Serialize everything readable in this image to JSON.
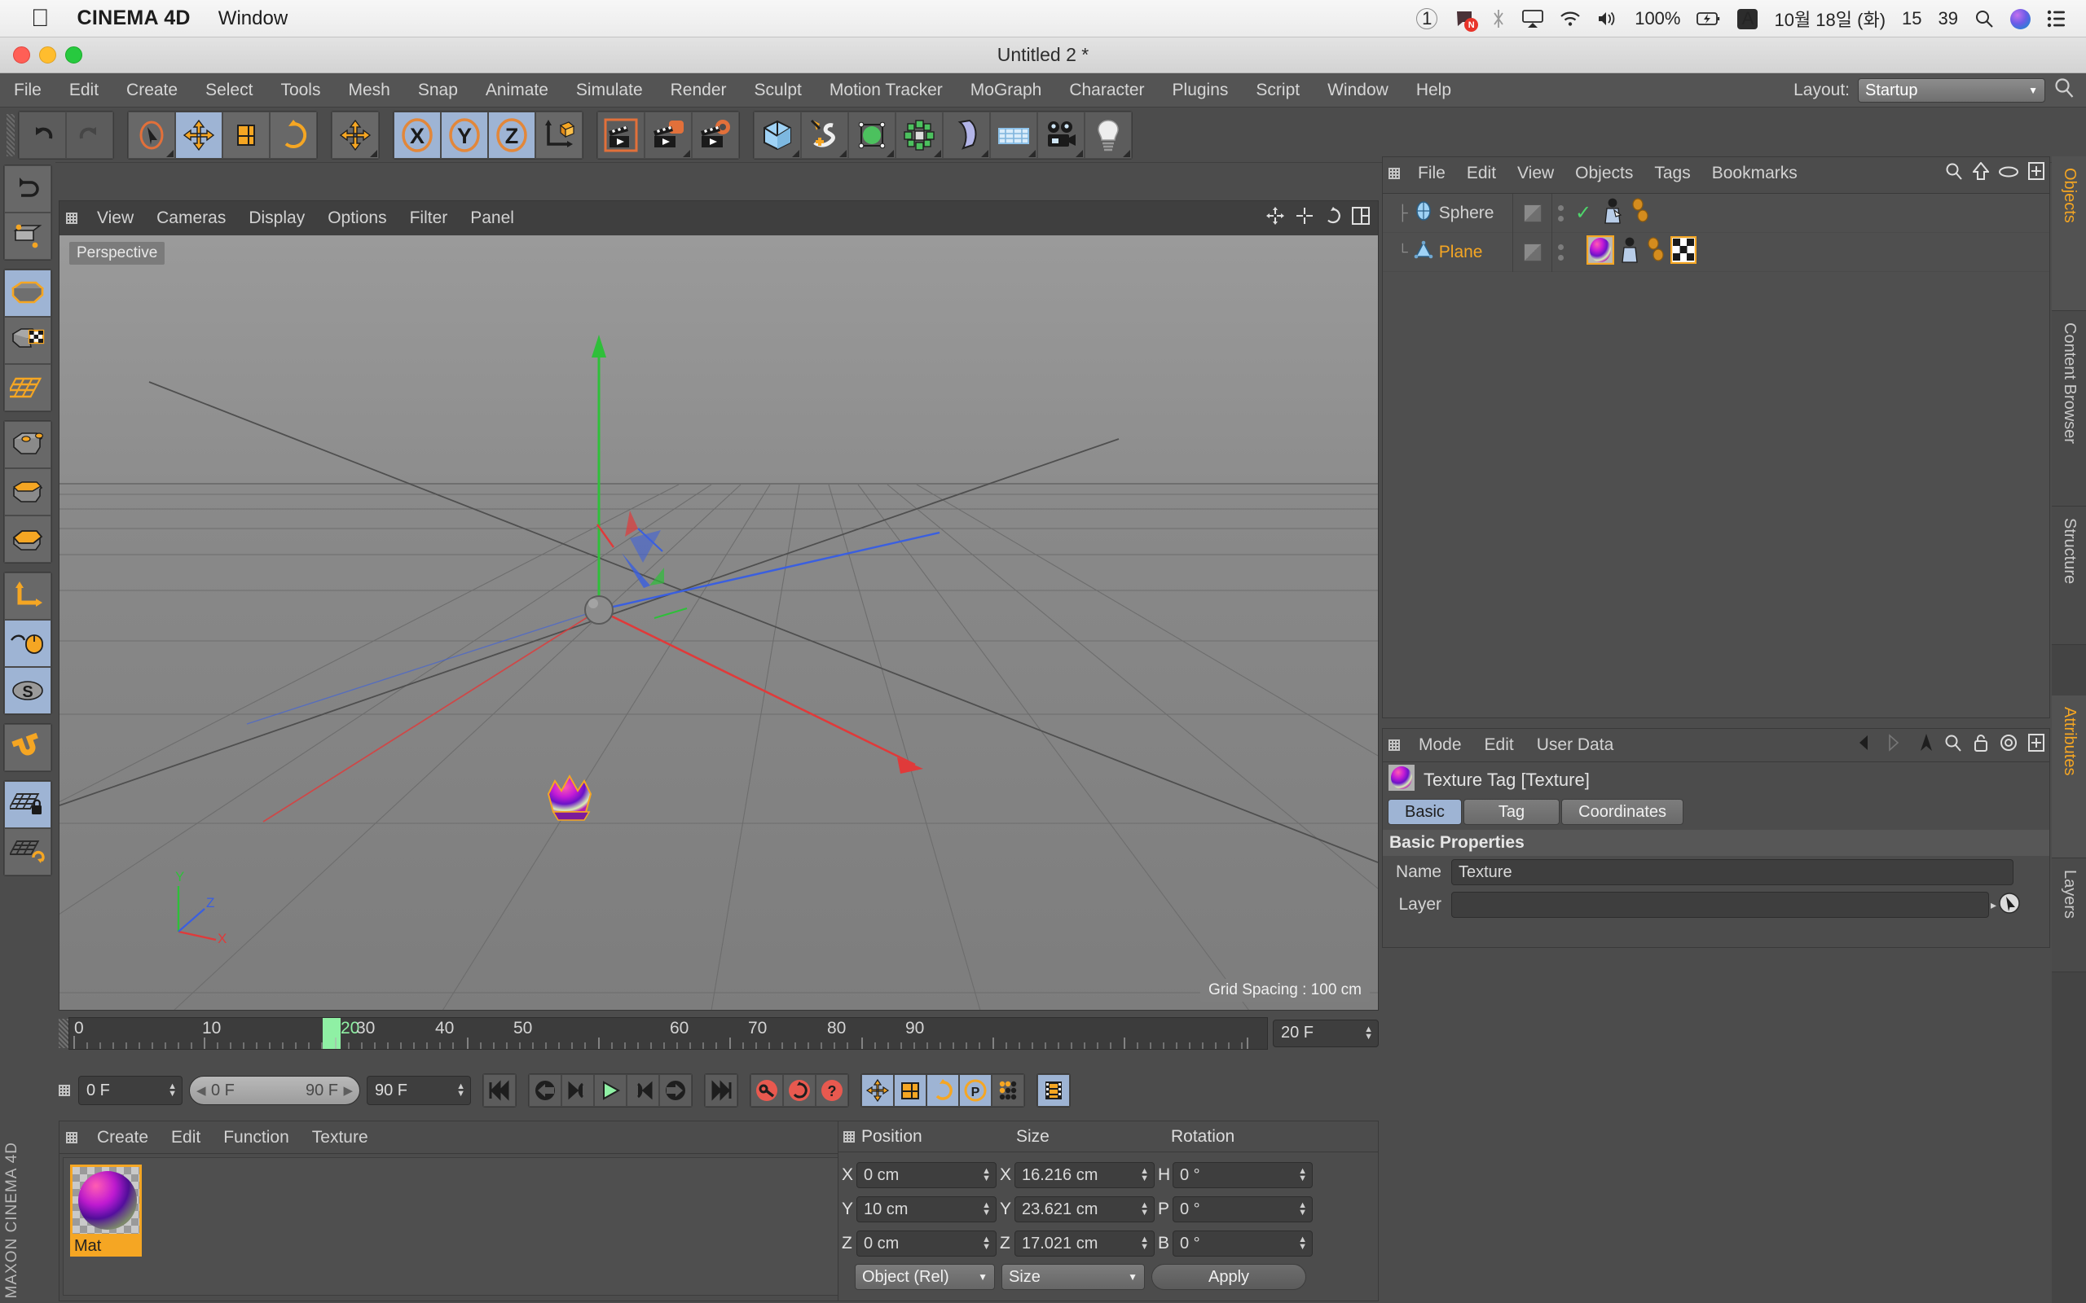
{
  "mac_menubar": {
    "apple_icon": "apple-icon",
    "app_name": "CINEMA 4D",
    "menus": [
      "Window"
    ],
    "status": {
      "space_number": "1",
      "notification_badge": "N",
      "battery_percent": "100%",
      "keyboard_layout": "A",
      "date": "10월 18일 (화)",
      "time_hour": "15",
      "time_minute": "39",
      "icons": [
        "bluetooth-icon",
        "airplay-icon",
        "wifi-icon",
        "volume-icon",
        "battery-charging-icon",
        "search-icon",
        "siri-icon",
        "control-center-icon"
      ]
    }
  },
  "window": {
    "title": "Untitled 2 *"
  },
  "main_menu": {
    "items": [
      "File",
      "Edit",
      "Create",
      "Select",
      "Tools",
      "Mesh",
      "Snap",
      "Animate",
      "Simulate",
      "Render",
      "Sculpt",
      "Motion Tracker",
      "MoGraph",
      "Character",
      "Plugins",
      "Script",
      "Window",
      "Help"
    ],
    "layout_label": "Layout:",
    "layout_value": "Startup",
    "search_icon": "search-icon"
  },
  "top_toolbar": {
    "groups": [
      {
        "name": "history",
        "buttons": [
          {
            "name": "undo-button",
            "icon": "undo-icon",
            "selected": false,
            "enabled": true
          },
          {
            "name": "redo-button",
            "icon": "redo-icon",
            "selected": false,
            "enabled": false
          }
        ]
      },
      {
        "name": "tools",
        "buttons": [
          {
            "name": "live-selection-tool",
            "icon": "live-selection-icon",
            "selected": false,
            "enabled": true
          },
          {
            "name": "move-tool",
            "icon": "move-icon",
            "selected": true,
            "enabled": true
          },
          {
            "name": "scale-tool",
            "icon": "scale-icon",
            "selected": false,
            "enabled": true
          },
          {
            "name": "rotate-tool",
            "icon": "rotate-icon",
            "selected": false,
            "enabled": true
          }
        ]
      },
      {
        "name": "transform",
        "buttons": [
          {
            "name": "move-duplicate-tool",
            "icon": "move-axis-icon",
            "selected": false,
            "enabled": true
          }
        ]
      },
      {
        "name": "axis-locks",
        "buttons": [
          {
            "name": "lock-x-axis",
            "icon": "x-axis-icon",
            "selected": true,
            "enabled": true
          },
          {
            "name": "lock-y-axis",
            "icon": "y-axis-icon",
            "selected": true,
            "enabled": true
          },
          {
            "name": "lock-z-axis",
            "icon": "z-axis-icon",
            "selected": true,
            "enabled": true
          },
          {
            "name": "world-object-coordinates",
            "icon": "world-axis-icon",
            "selected": false,
            "enabled": true
          }
        ]
      },
      {
        "name": "render",
        "buttons": [
          {
            "name": "render-view-button",
            "icon": "render-view-icon",
            "selected": false,
            "enabled": true
          },
          {
            "name": "render-region-button",
            "icon": "render-region-icon",
            "selected": false,
            "enabled": true
          },
          {
            "name": "render-settings-button",
            "icon": "render-settings-icon",
            "selected": false,
            "enabled": true
          }
        ]
      },
      {
        "name": "primitives",
        "buttons": [
          {
            "name": "add-cube-button",
            "icon": "cube-icon",
            "selected": false,
            "enabled": true
          },
          {
            "name": "add-spline-button",
            "icon": "pen-spline-icon",
            "selected": false,
            "enabled": true
          },
          {
            "name": "add-generator-button",
            "icon": "generator-icon",
            "selected": false,
            "enabled": true
          },
          {
            "name": "add-array-button",
            "icon": "array-icon",
            "selected": false,
            "enabled": true
          },
          {
            "name": "add-bend-deformer-button",
            "icon": "bend-deformer-icon",
            "selected": false,
            "enabled": true
          },
          {
            "name": "add-floor-button",
            "icon": "floor-grid-icon",
            "selected": false,
            "enabled": true
          },
          {
            "name": "add-camera-button",
            "icon": "camera-icon",
            "selected": false,
            "enabled": true
          },
          {
            "name": "add-light-button",
            "icon": "light-bulb-icon",
            "selected": false,
            "enabled": true
          }
        ]
      }
    ]
  },
  "left_toolbar": {
    "groups": [
      {
        "buttons": [
          {
            "name": "undo-view-button",
            "icon": "undo-view-icon",
            "selected": false
          },
          {
            "name": "editable-object-button",
            "icon": "make-editable-icon",
            "selected": false
          }
        ]
      },
      {
        "buttons": [
          {
            "name": "model-mode-button",
            "icon": "model-mode-icon",
            "selected": true
          },
          {
            "name": "texture-mode-button",
            "icon": "texture-mode-icon",
            "selected": false
          },
          {
            "name": "workplane-button",
            "icon": "workplane-icon",
            "selected": false
          }
        ]
      },
      {
        "buttons": [
          {
            "name": "points-mode-button",
            "icon": "points-mode-icon",
            "selected": false
          },
          {
            "name": "edges-mode-button",
            "icon": "edges-mode-icon",
            "selected": false
          },
          {
            "name": "polygons-mode-button",
            "icon": "polygons-mode-icon",
            "selected": false
          }
        ]
      },
      {
        "buttons": [
          {
            "name": "enable-axis-modification-button",
            "icon": "axis-modify-icon",
            "selected": false
          },
          {
            "name": "viewport-solo-button",
            "icon": "mouse-path-icon",
            "selected": true
          },
          {
            "name": "soft-selection-button",
            "icon": "soft-selection-icon",
            "selected": true
          }
        ]
      },
      {
        "buttons": [
          {
            "name": "snap-button",
            "icon": "magnet-icon",
            "selected": false
          }
        ]
      },
      {
        "buttons": [
          {
            "name": "lock-workplane-button",
            "icon": "workplane-lock-icon",
            "selected": true
          },
          {
            "name": "planar-workplane-button",
            "icon": "workplane-rotate-icon",
            "selected": false
          }
        ]
      }
    ],
    "brand": "MAXON CINEMA 4D"
  },
  "viewport": {
    "menus": [
      "View",
      "Cameras",
      "Display",
      "Options",
      "Filter",
      "Panel"
    ],
    "header_icons": [
      "axis-move-icon",
      "axis-scale-icon",
      "rotate-view-icon",
      "panel-layout-icon"
    ],
    "label": "Perspective",
    "grid_spacing": "Grid Spacing : 100 cm",
    "axis_gizmo": {
      "x": "X",
      "y": "Y",
      "z": "Z"
    }
  },
  "timeline": {
    "ruler_labels": [
      "0",
      "10",
      "20",
      "30",
      "40",
      "50",
      "60",
      "70",
      "80",
      "90"
    ],
    "playhead_frame": "20",
    "current_frame_field": "20 F"
  },
  "anim_bar": {
    "current_frame": "0 F",
    "range_start": "0 F",
    "range_end": "90 F",
    "max_frame": "90 F",
    "buttons": [
      {
        "name": "go-to-start-button",
        "icon": "jump-start-icon",
        "selected": false
      },
      {
        "name": "play-backwards-button",
        "icon": "play-back-icon",
        "selected": false
      },
      {
        "name": "previous-frame-button",
        "icon": "step-back-icon",
        "selected": false
      },
      {
        "name": "play-forwards-button",
        "icon": "play-icon",
        "selected": false
      },
      {
        "name": "next-frame-button",
        "icon": "step-forward-icon",
        "selected": false
      },
      {
        "name": "play-loop-button",
        "icon": "loop-icon",
        "selected": false
      },
      {
        "name": "go-to-end-button",
        "icon": "jump-end-icon",
        "selected": false
      },
      {
        "name": "record-active-objects-button",
        "icon": "record-key-icon",
        "selected": false
      },
      {
        "name": "autokeying-button",
        "icon": "autokey-icon",
        "selected": false
      },
      {
        "name": "keyframe-selection-button",
        "icon": "key-question-icon",
        "selected": false
      },
      {
        "name": "position-key-button",
        "icon": "position-key-icon",
        "selected": true
      },
      {
        "name": "scale-key-button",
        "icon": "scale-key-icon",
        "selected": true
      },
      {
        "name": "rotation-key-button",
        "icon": "rotation-key-icon",
        "selected": true
      },
      {
        "name": "parameter-key-button",
        "icon": "param-key-icon",
        "selected": true
      },
      {
        "name": "point-level-animation-button",
        "icon": "pla-dots-icon",
        "selected": false
      },
      {
        "name": "timeline-button",
        "icon": "filmstrip-icon",
        "selected": true
      }
    ]
  },
  "material_manager": {
    "menus": [
      "Create",
      "Edit",
      "Function",
      "Texture"
    ],
    "materials": [
      {
        "name": "Mat",
        "selected": true,
        "thumb": "material-sphere-thumb"
      }
    ]
  },
  "coordinates_manager": {
    "columns": [
      "Position",
      "Size",
      "Rotation"
    ],
    "rows": [
      {
        "pos_label": "X",
        "pos_value": "0 cm",
        "size_label": "X",
        "size_value": "16.216 cm",
        "rot_label": "H",
        "rot_value": "0 °"
      },
      {
        "pos_label": "Y",
        "pos_value": "10 cm",
        "size_label": "Y",
        "size_value": "23.621 cm",
        "rot_label": "P",
        "rot_value": "0 °"
      },
      {
        "pos_label": "Z",
        "pos_value": "0 cm",
        "size_label": "Z",
        "size_value": "17.021 cm",
        "rot_label": "B",
        "rot_value": "0 °"
      }
    ],
    "coord_system": "Object (Rel)",
    "size_mode": "Size",
    "apply_label": "Apply"
  },
  "objects_manager": {
    "menus": [
      "File",
      "Edit",
      "View",
      "Objects",
      "Tags",
      "Bookmarks"
    ],
    "header_icons": [
      "search-icon",
      "up-arrow-icon",
      "eye-icon",
      "plus-box-icon"
    ],
    "objects": [
      {
        "name": "Sphere",
        "icon": "sphere-object-icon",
        "selected": false,
        "tags": [
          "phong-tag-icon",
          "light-tag-icon",
          "phong-amber-icon",
          "phong-amber-icon-2"
        ],
        "checked": true
      },
      {
        "name": "Plane",
        "icon": "plane-object-icon",
        "selected": true,
        "tags": [
          "texture-tag-icon",
          "phong-tag-icon",
          "phong-amber-icon",
          "phong-amber-icon-2",
          "uvw-tag-icon"
        ],
        "checked": false
      }
    ]
  },
  "attributes_manager": {
    "menus": [
      "Mode",
      "Edit",
      "User Data"
    ],
    "header_icons": [
      "back-arrow-icon",
      "forward-arrow-icon",
      "up-pointer-icon",
      "search-icon",
      "lock-icon",
      "target-icon",
      "plus-box-icon"
    ],
    "object_title": "Texture Tag [Texture]",
    "object_icon": "texture-tag-icon",
    "tabs": [
      {
        "label": "Basic",
        "selected": true
      },
      {
        "label": "Tag",
        "selected": false
      },
      {
        "label": "Coordinates",
        "selected": false
      }
    ],
    "section_title": "Basic Properties",
    "fields": [
      {
        "label": "Name",
        "value": "Texture"
      },
      {
        "label": "Layer",
        "value": ""
      }
    ]
  },
  "right_tabs": [
    {
      "label": "Objects",
      "active": true
    },
    {
      "label": "Content Browser",
      "active": false
    },
    {
      "label": "Structure",
      "active": false
    },
    {
      "label": "Attributes",
      "active": true
    },
    {
      "label": "Layers",
      "active": false
    }
  ],
  "colors": {
    "accent_orange": "#f5a623",
    "selected_blue": "#9eb4d4",
    "panel_bg": "#4c4c4c",
    "field_bg": "#3e3e3e",
    "playhead_green": "#8ff0a4",
    "red_key": "#e8594f"
  }
}
